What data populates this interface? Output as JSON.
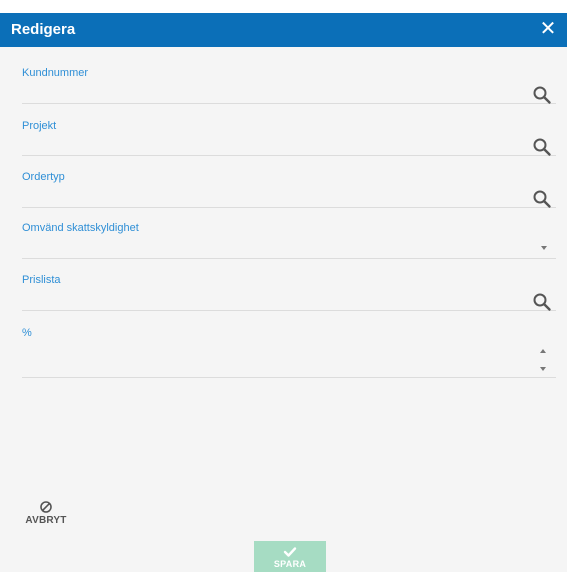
{
  "dialog": {
    "title": "Redigera",
    "close_icon": "close-icon"
  },
  "fields": [
    {
      "label": "Kundnummer",
      "value": "",
      "control": "search-icon"
    },
    {
      "label": "Projekt",
      "value": "",
      "control": "search-icon"
    },
    {
      "label": "Ordertyp",
      "value": "",
      "control": "search-icon"
    },
    {
      "label": "Omvänd skattskyldighet",
      "value": "",
      "control": "dropdown-caret-icon"
    },
    {
      "label": "Prislista",
      "value": "",
      "control": "search-icon"
    },
    {
      "label": "%",
      "value": "",
      "control": "spinner-icons"
    }
  ],
  "footer": {
    "cancel_label": "AVBRYT",
    "cancel_icon": "ban-icon",
    "save_label": "SPARA",
    "save_icon": "checkmark-icon"
  },
  "colors": {
    "header_bg": "#0b6fb8",
    "label_blue": "#2f8fd6",
    "save_bg": "#a6dcc3",
    "background": "#f5f5f5"
  }
}
